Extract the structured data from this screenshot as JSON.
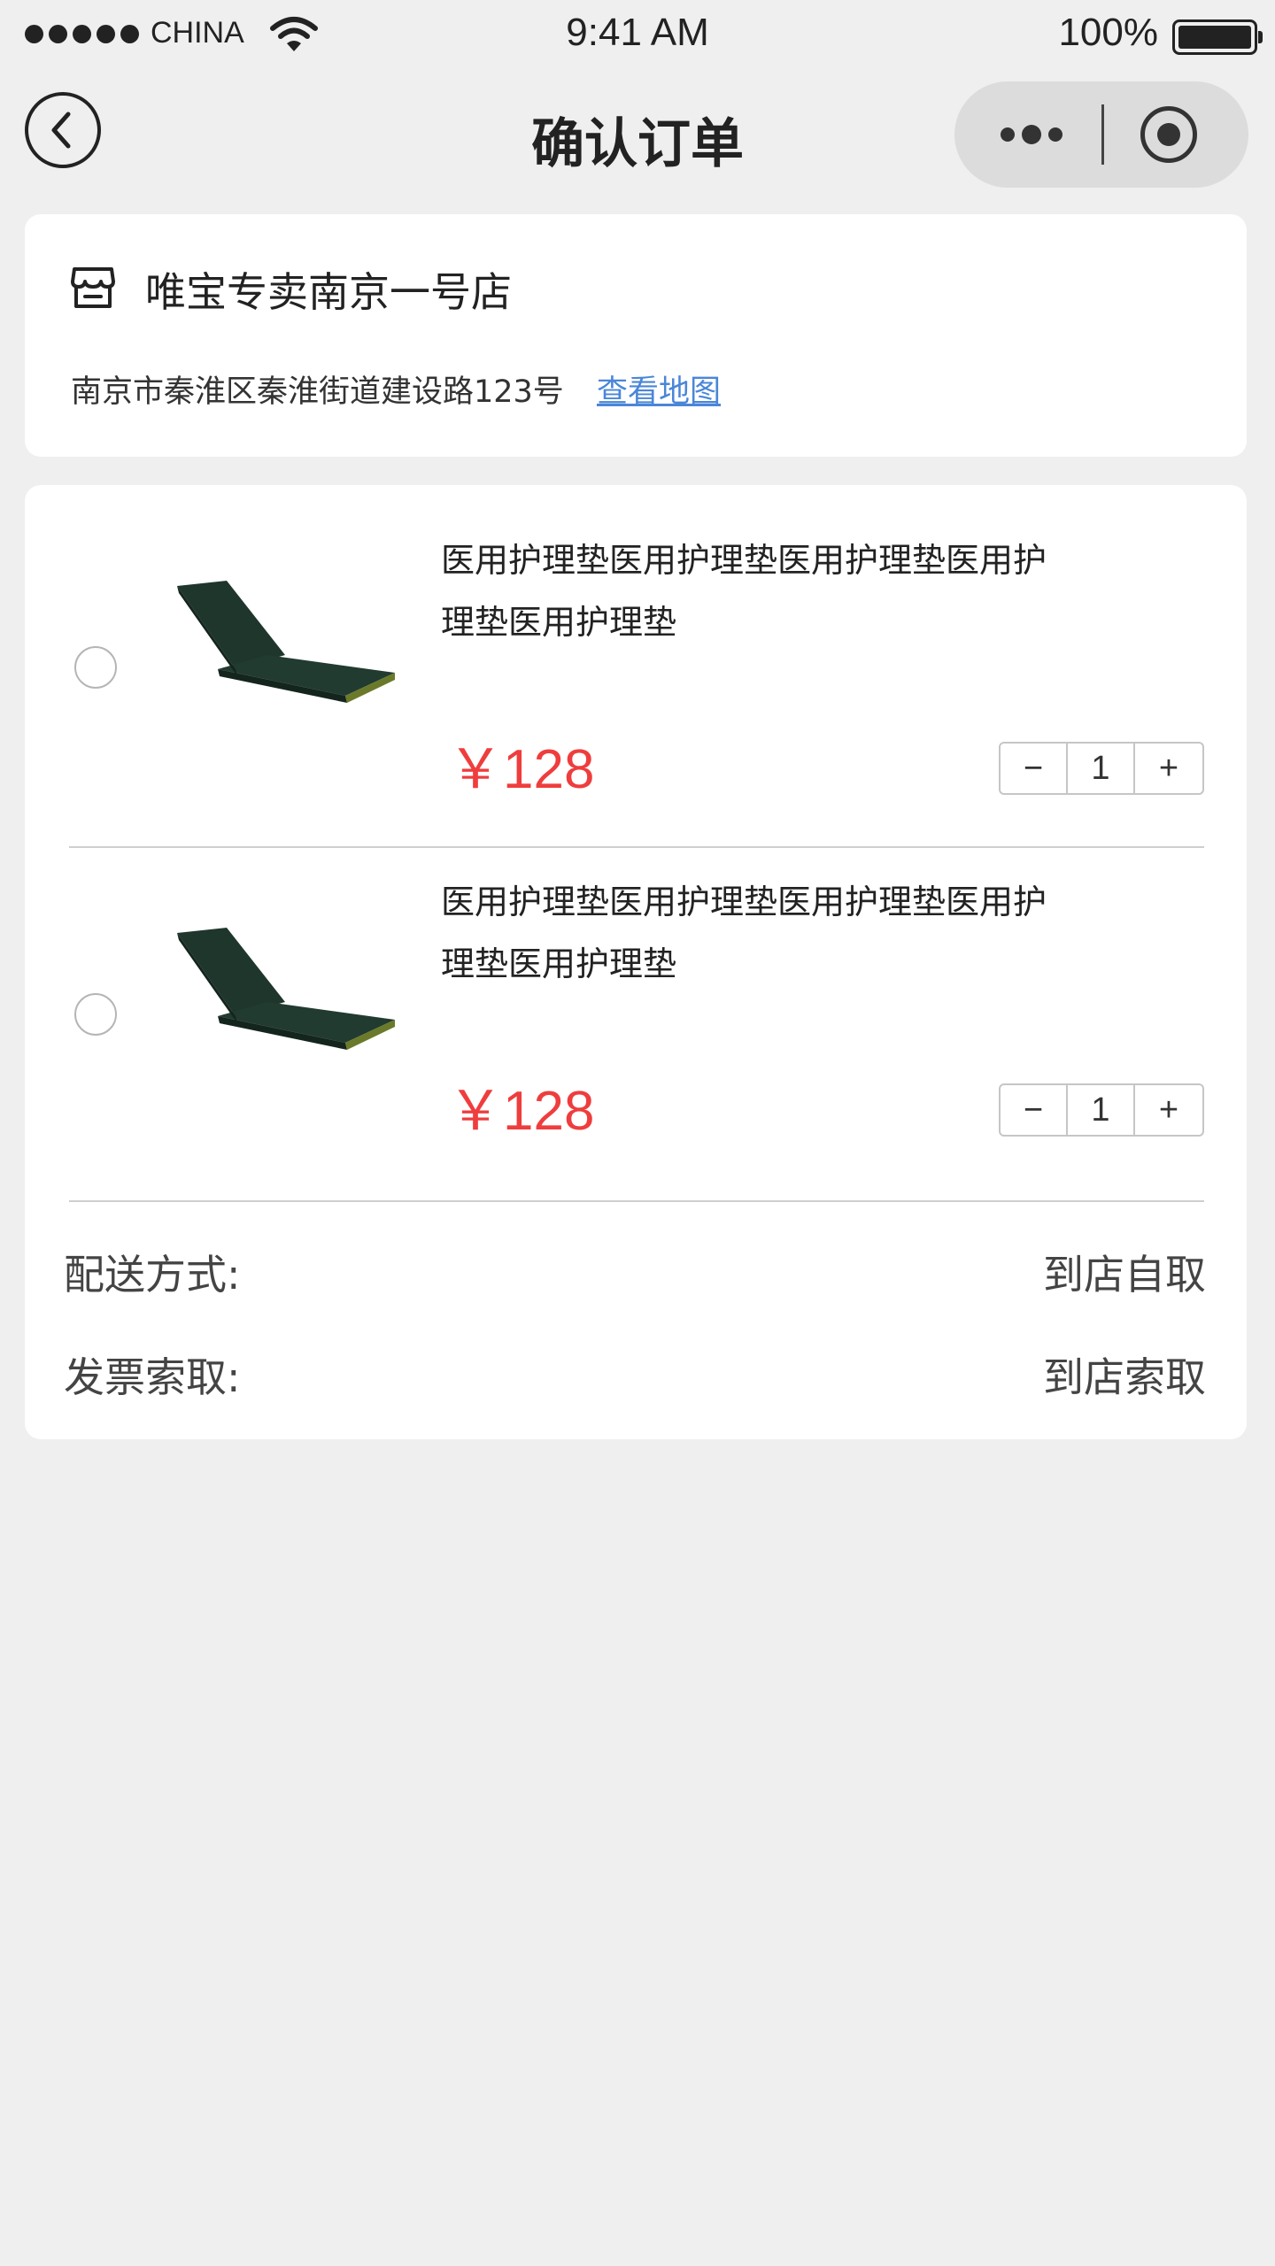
{
  "status_bar": {
    "carrier": "CHINA",
    "time": "9:41 AM",
    "battery": "100%",
    "battery_level": 1.0
  },
  "nav": {
    "title": "确认订单",
    "back_icon": "chevron-left-icon",
    "more_icon": "more-dots-icon",
    "close_icon": "target-circle-icon"
  },
  "store": {
    "icon": "store-icon",
    "name": "唯宝专卖南京一号店",
    "address": "南京市秦淮区秦淮街道建设路123号",
    "map_link": "查看地图"
  },
  "products": [
    {
      "name": "医用护理垫医用护理垫医用护理垫医用护理垫医用护理垫",
      "price": "￥128",
      "quantity": "1",
      "selected": false
    },
    {
      "name": "医用护理垫医用护理垫医用护理垫医用护理垫医用护理垫",
      "price": "￥128",
      "quantity": "1",
      "selected": false
    }
  ],
  "stepper": {
    "minus": "−",
    "plus": "+"
  },
  "delivery": {
    "label": "配送方式:",
    "value": "到店自取"
  },
  "invoice": {
    "label": "发票索取:",
    "value": "到店索取"
  },
  "colors": {
    "price": "#ef3d3d",
    "link": "#4a86d8",
    "background": "#efefef",
    "mattress": "#223b30"
  }
}
